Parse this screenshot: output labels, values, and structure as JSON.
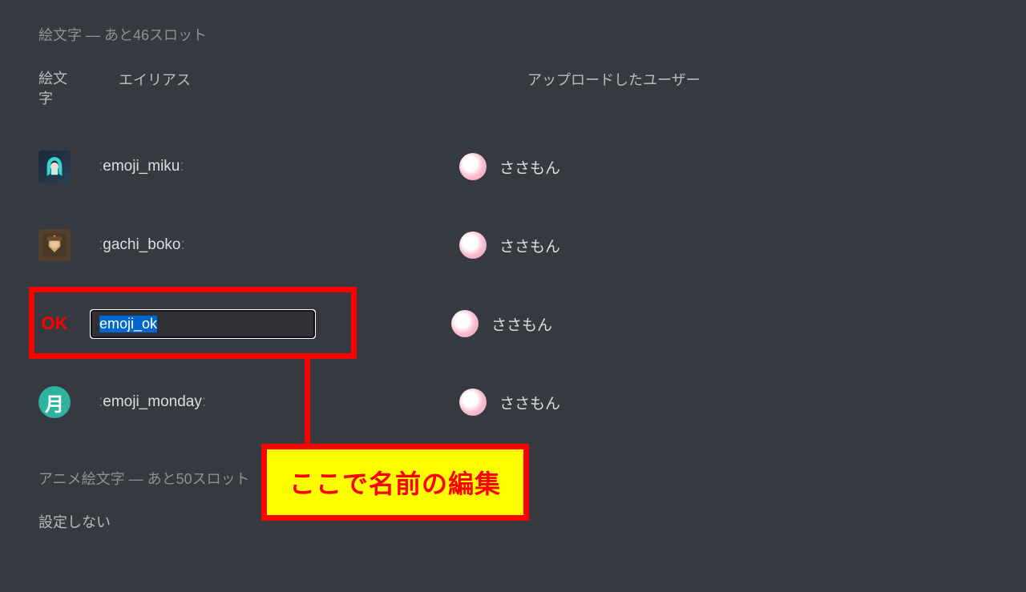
{
  "section_header": "絵文字 — あと46スロット",
  "columns": {
    "emoji": "絵文\n字",
    "alias": "エイリアス",
    "uploader": "アップロードしたユーザー"
  },
  "rows": [
    {
      "icon": "miku",
      "alias": "emoji_miku",
      "uploader": "ささもん",
      "editing": false
    },
    {
      "icon": "gachi",
      "alias": "gachi_boko",
      "uploader": "ささもん",
      "editing": false
    },
    {
      "icon": "ok",
      "alias": "emoji_ok",
      "uploader": "ささもん",
      "editing": true
    },
    {
      "icon": "monday",
      "alias": "emoji_monday",
      "uploader": "ささもん",
      "editing": false
    }
  ],
  "icon_text": {
    "ok": "OK",
    "monday": "月"
  },
  "footer_header": "アニメ絵文字 — あと50スロット",
  "footer_none": "設定しない",
  "callout": "ここで名前の編集"
}
